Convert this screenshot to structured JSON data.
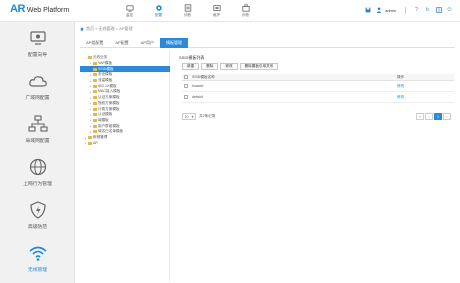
{
  "app": {
    "logo_main": "AR",
    "logo_sub": "Web Platform"
  },
  "topnav": [
    {
      "label": "监控",
      "icon": "monitor-icon"
    },
    {
      "label": "配置",
      "icon": "gear-icon",
      "active": true
    },
    {
      "label": "诊断",
      "icon": "diagnose-icon"
    },
    {
      "label": "维护",
      "icon": "maintain-icon"
    },
    {
      "label": "诊断",
      "icon": "toolbox-icon"
    }
  ],
  "user": {
    "name": "admin"
  },
  "sidebar": [
    {
      "label": "配置向导",
      "icon": "wizard-icon"
    },
    {
      "label": "广域网配置",
      "icon": "wan-icon"
    },
    {
      "label": "局域网配置",
      "icon": "lan-icon"
    },
    {
      "label": "上网行为管理",
      "icon": "globe-icon"
    },
    {
      "label": "高级防范",
      "icon": "shield-icon"
    },
    {
      "label": "无线管理",
      "icon": "wifi-icon",
      "active": true
    }
  ],
  "breadcrumb": "首页 > 无线管理 > AP管理",
  "tabs": [
    {
      "label": "AP组配置"
    },
    {
      "label": "AP配置"
    },
    {
      "label": "AP用户"
    },
    {
      "label": "模板管理",
      "active": true
    }
  ],
  "tree": [
    {
      "label": "无线业务",
      "level": 0,
      "toggle": "−"
    },
    {
      "label": "VAP模板",
      "level": 1,
      "toggle": "+"
    },
    {
      "label": "SSID模板",
      "level": 1,
      "toggle": "+",
      "selected": true
    },
    {
      "label": "安全模板",
      "level": 1,
      "toggle": "+"
    },
    {
      "label": "流量模板",
      "level": 1,
      "toggle": "+"
    },
    {
      "label": "802.1X模板",
      "level": 1,
      "toggle": "+"
    },
    {
      "label": "MAC接入模板",
      "level": 1,
      "toggle": "+"
    },
    {
      "label": "认证方案模板",
      "level": 1,
      "toggle": "+"
    },
    {
      "label": "授权方案模板",
      "level": 1,
      "toggle": "+"
    },
    {
      "label": "计费方案模板",
      "level": 1,
      "toggle": "+"
    },
    {
      "label": "认证模板",
      "level": 1,
      "toggle": "+"
    },
    {
      "label": "域模板",
      "level": 1,
      "toggle": "+"
    },
    {
      "label": "用户群组模板",
      "level": 1,
      "toggle": "+"
    },
    {
      "label": "域名白名单模板",
      "level": 1,
      "toggle": "+"
    },
    {
      "label": "射频管理",
      "level": 0,
      "toggle": "+"
    },
    {
      "label": "AP",
      "level": 0,
      "toggle": "+"
    }
  ],
  "panel": {
    "title": "SSID模板列表",
    "buttons": [
      "新建",
      "删除",
      "修改",
      "删除模板引用关系"
    ],
    "columns": {
      "name": "SSID模板名称",
      "op": "操作"
    },
    "rows": [
      {
        "name": "huawei",
        "op": "修改"
      },
      {
        "name": "default",
        "op": "修改"
      }
    ],
    "page_size": "10",
    "total": "共2条记录",
    "current_page": "1"
  }
}
